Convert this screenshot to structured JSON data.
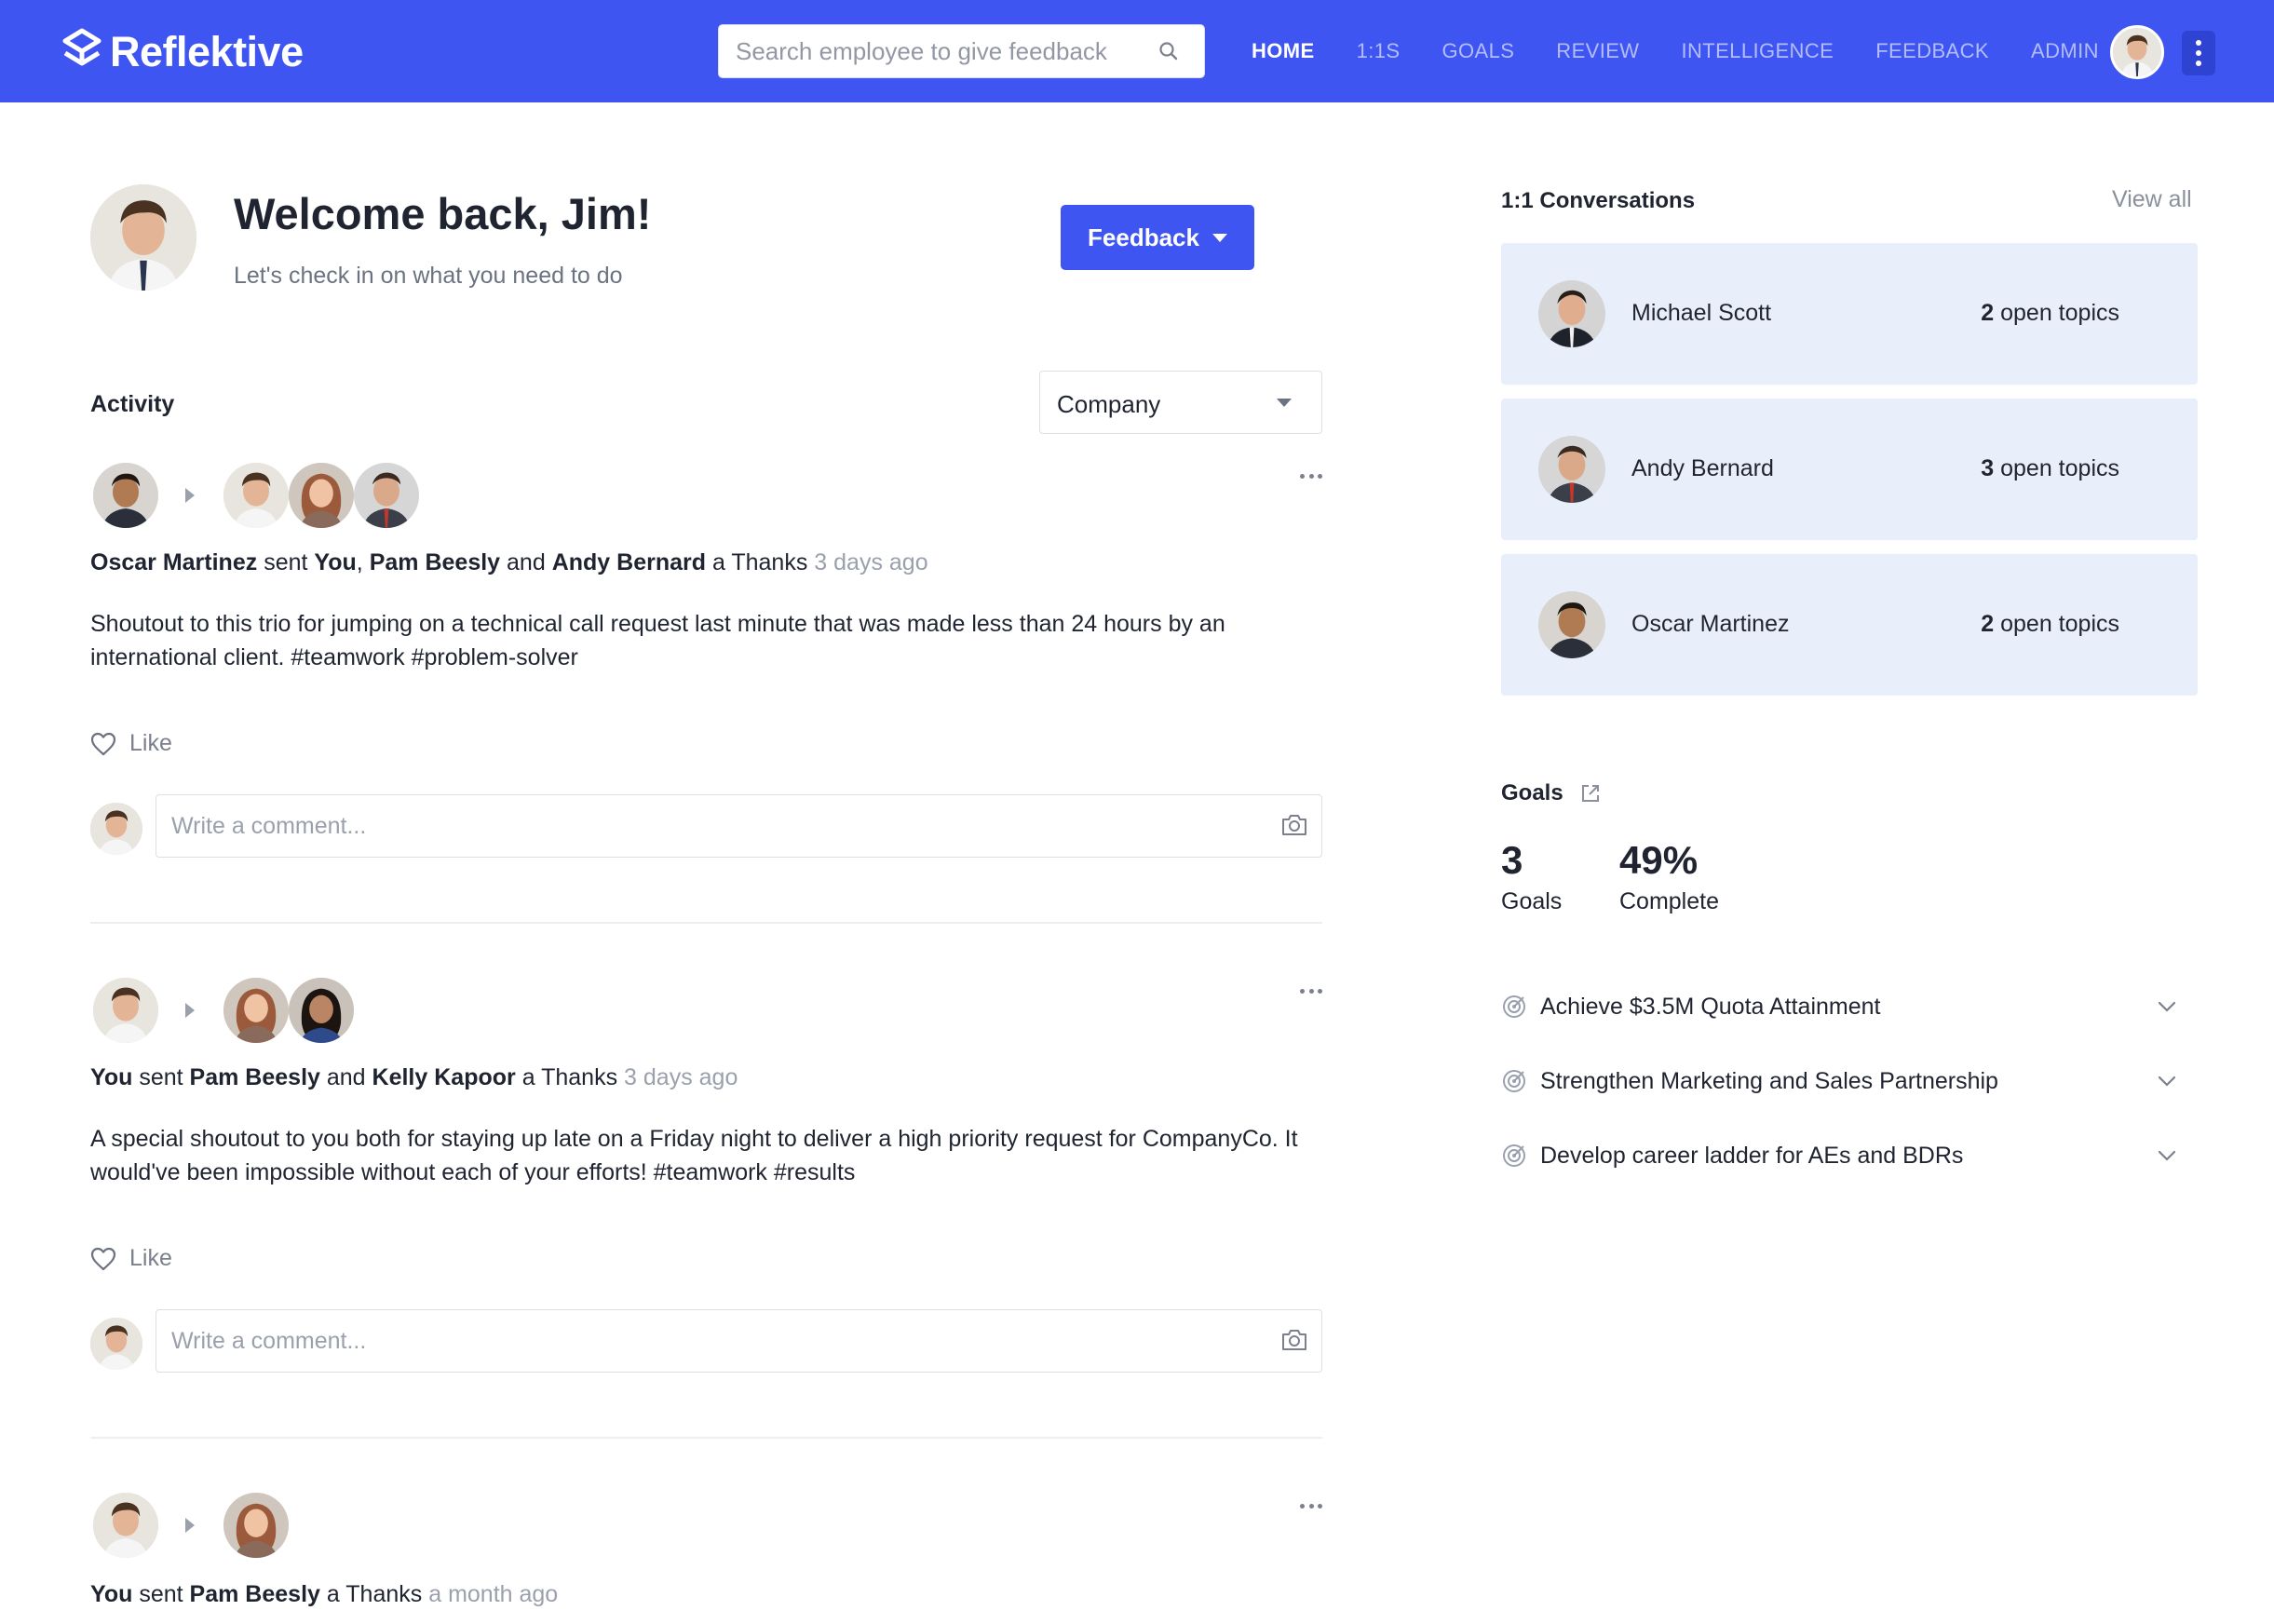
{
  "header": {
    "brand": "Reflektive",
    "search_placeholder": "Search employee to give feedback",
    "nav": [
      {
        "label": "HOME",
        "active": true
      },
      {
        "label": "1:1S"
      },
      {
        "label": "GOALS"
      },
      {
        "label": "REVIEW"
      },
      {
        "label": "INTELLIGENCE"
      },
      {
        "label": "FEEDBACK"
      },
      {
        "label": "ADMIN"
      }
    ]
  },
  "welcome": {
    "title": "Welcome back, Jim!",
    "subtitle": "Let's check in on what you need to do",
    "feedback_button": "Feedback"
  },
  "activity": {
    "label": "Activity",
    "filter_value": "Company",
    "like_label": "Like",
    "comment_placeholder": "Write a comment...",
    "posts": [
      {
        "sender": "Oscar Martinez",
        "verb": "sent",
        "recipients": [
          "You",
          "Pam Beesly",
          "Andy Bernard"
        ],
        "kind": "a Thanks",
        "time": "3 days ago",
        "body": "Shoutout to this trio for jumping on a technical call request last minute that was made less than 24 hours by an international client. #teamwork #problem-solver"
      },
      {
        "sender": "You",
        "verb": "sent",
        "recipients": [
          "Pam Beesly",
          "Kelly Kapoor"
        ],
        "kind": "a Thanks",
        "time": "3 days ago",
        "body": "A special shoutout to you both for staying up late on a Friday night to deliver a high priority request for CompanyCo. It would've been impossible without each of your efforts! #teamwork #results"
      },
      {
        "sender": "You",
        "verb": "sent",
        "recipients": [
          "Pam Beesly"
        ],
        "kind": "a Thanks",
        "time": "a month ago"
      }
    ]
  },
  "conversations": {
    "title": "1:1 Conversations",
    "view_all": "View all",
    "topics_suffix": "open topics",
    "items": [
      {
        "name": "Michael Scott",
        "count": "2"
      },
      {
        "name": "Andy Bernard",
        "count": "3"
      },
      {
        "name": "Oscar Martinez",
        "count": "2"
      }
    ]
  },
  "goals": {
    "title": "Goals",
    "count": "3",
    "count_label": "Goals",
    "complete": "49%",
    "complete_label": "Complete",
    "items": [
      "Achieve $3.5M Quota Attainment",
      "Strengthen Marketing and Sales Partnership",
      "Develop career ladder for AEs and BDRs"
    ]
  },
  "colors": {
    "brand": "#3e55f2",
    "card": "#e8effb",
    "muted": "#9aa0ac"
  },
  "icons": [
    "reflektive-logo-icon",
    "search-icon",
    "kebab-menu-icon",
    "caret-down-icon",
    "more-dots-icon",
    "heart-icon",
    "camera-icon",
    "external-link-icon",
    "target-icon",
    "chevron-down-icon"
  ]
}
